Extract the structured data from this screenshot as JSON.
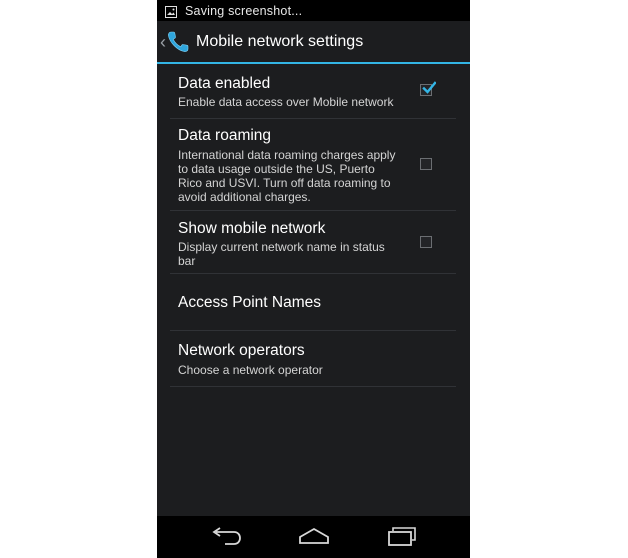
{
  "status_bar": {
    "notification_text": "Saving screenshot...",
    "icon": "image-icon"
  },
  "action_bar": {
    "title": "Mobile network settings",
    "up_icon": "chevron-left-icon",
    "app_icon": "phone-icon",
    "accent_color": "#33b5e5"
  },
  "settings": {
    "items": [
      {
        "title": "Data enabled",
        "summary": "Enable data access over Mobile network",
        "checked": true
      },
      {
        "title": "Data roaming",
        "summary": "International data roaming charges apply to data usage outside the US, Puerto Rico and USVI. Turn off data roaming to avoid additional charges.",
        "checked": false
      },
      {
        "title": "Show mobile network",
        "summary": "Display current network name in status bar",
        "checked": false
      },
      {
        "title": "Access Point Names"
      },
      {
        "title": "Network operators",
        "summary": "Choose a network operator"
      }
    ]
  },
  "nav_bar": {
    "buttons": [
      "back-icon",
      "home-icon",
      "recent-apps-icon"
    ]
  }
}
